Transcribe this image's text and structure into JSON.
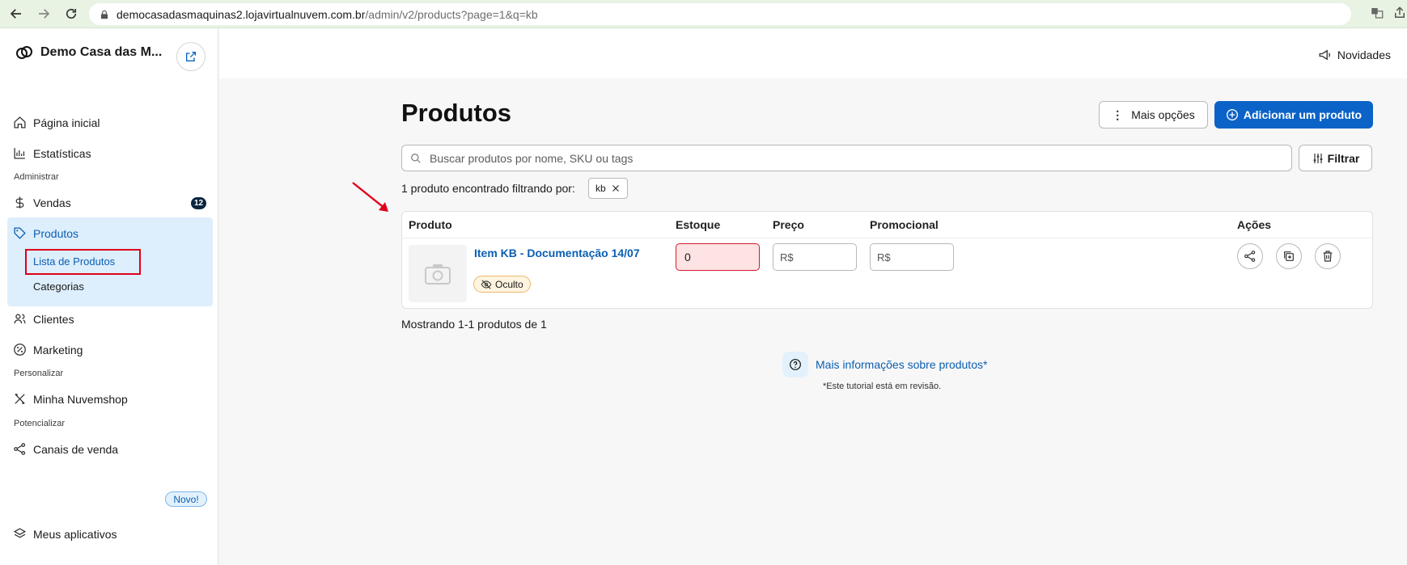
{
  "browser": {
    "url_host": "democasadasmaquinas2.lojavirtualnuvem.com.br",
    "url_path": "/admin/v2/products?page=1&q=kb"
  },
  "sidebar": {
    "store_name": "Demo Casa das M...",
    "items": [
      {
        "label": "Página inicial",
        "icon": "home-icon"
      },
      {
        "label": "Estatísticas",
        "icon": "bar-chart-icon"
      },
      {
        "label": "Vendas",
        "icon": "dollar-icon",
        "badge": "12"
      },
      {
        "label": "Produtos",
        "icon": "tag-icon"
      },
      {
        "label": "Clientes",
        "icon": "users-icon"
      },
      {
        "label": "Marketing",
        "icon": "percent-icon"
      },
      {
        "label": "Minha Nuvemshop",
        "icon": "tools-icon"
      },
      {
        "label": "Canais de venda",
        "icon": "share-nodes-icon",
        "badge": "Novo!"
      },
      {
        "label": "Meus aplicativos",
        "icon": "apps-icon"
      }
    ],
    "sections": [
      "Administrar",
      "Personalizar",
      "Potencializar"
    ],
    "products_sub": [
      "Lista de Produtos",
      "Categorias"
    ]
  },
  "header": {
    "news_label": "Novidades"
  },
  "main": {
    "title": "Produtos",
    "more_options_label": "Mais opções",
    "add_product_label": "Adicionar um produto",
    "search_placeholder": "Buscar produtos por nome, SKU ou tags",
    "filter_label": "Filtrar",
    "found_text": "1 produto encontrado filtrando por:",
    "filter_chip": "kb",
    "columns": [
      "Produto",
      "Estoque",
      "Preço",
      "Promocional",
      "Ações"
    ],
    "rows": [
      {
        "name": "Item KB - Documentação 14/07",
        "status": "Oculto",
        "stock": "0",
        "price_prefix": "R$",
        "promo_prefix": "R$"
      }
    ],
    "showing_text": "Mostrando 1-1 produtos de 1",
    "help_link": "Mais informações sobre produtos*",
    "help_note": "*Este tutorial está em revisão."
  },
  "colors": {
    "primary": "#0b63c7",
    "active_bg": "#ddeefc",
    "highlight_red": "#e0001b"
  }
}
